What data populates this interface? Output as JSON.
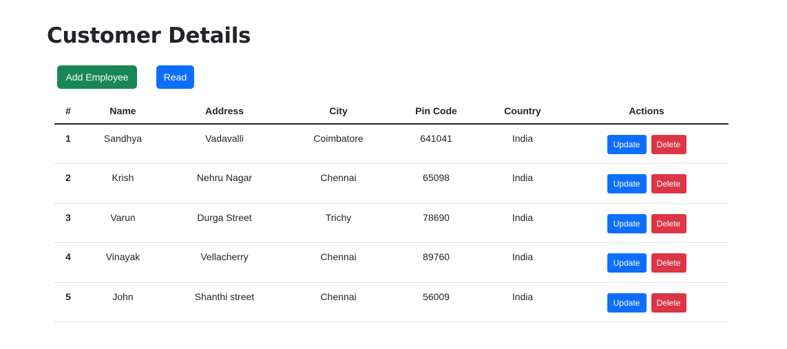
{
  "page": {
    "title": "Customer Details",
    "add_button": "Add Employee",
    "read_button": "Read"
  },
  "table": {
    "headers": [
      "#",
      "Name",
      "Address",
      "City",
      "Pin Code",
      "Country",
      "Actions"
    ],
    "rows": [
      {
        "id": "1",
        "name": "Sandhya",
        "address": "Vadavalli",
        "city": "Coimbatore",
        "pin": "641041",
        "country": "India"
      },
      {
        "id": "2",
        "name": "Krish",
        "address": "Nehru Nagar",
        "city": "Chennai",
        "pin": "65098",
        "country": "India"
      },
      {
        "id": "3",
        "name": "Varun",
        "address": "Durga Street",
        "city": "Trichy",
        "pin": "78690",
        "country": "India"
      },
      {
        "id": "4",
        "name": "Vinayak",
        "address": "Vellacherry",
        "city": "Chennai",
        "pin": "89760",
        "country": "India"
      },
      {
        "id": "5",
        "name": "John",
        "address": "Shanthi street",
        "city": "Chennai",
        "pin": "56009",
        "country": "India"
      }
    ],
    "update_label": "Update",
    "delete_label": "Delete"
  },
  "colors": {
    "success": "#198754",
    "primary": "#0d6efd",
    "danger": "#dc3545",
    "text": "#212529"
  }
}
